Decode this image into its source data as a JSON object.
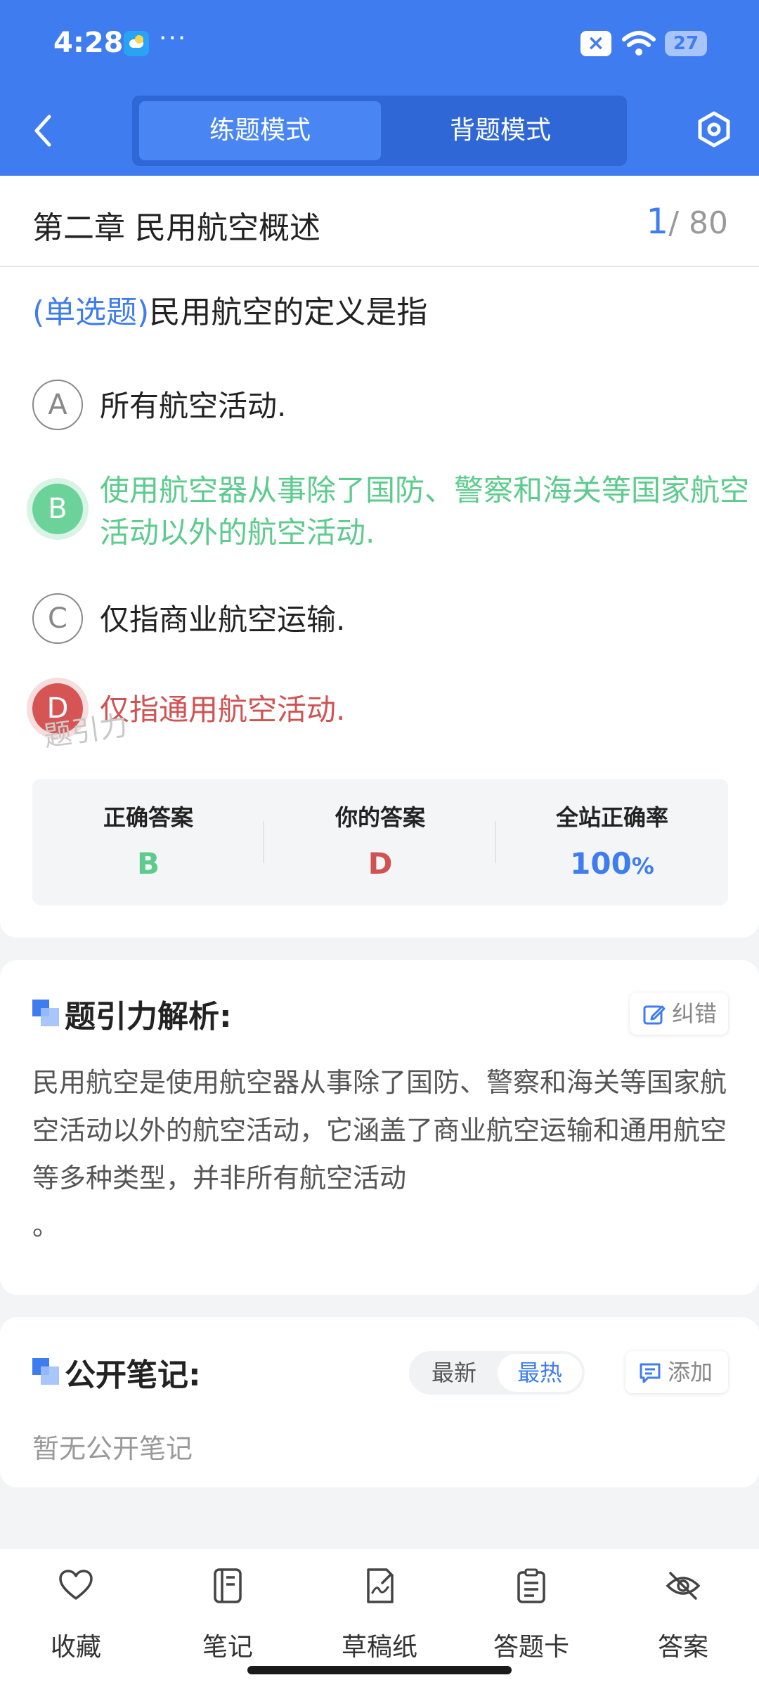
{
  "status_bar": {
    "time": "4:28",
    "more": "···",
    "battery": "27"
  },
  "header": {
    "tabs": [
      {
        "label": "练题模式",
        "active": true
      },
      {
        "label": "背题模式",
        "active": false
      }
    ]
  },
  "chapter": {
    "title": "第二章 民用航空概述",
    "current": "1",
    "total": "/ 80"
  },
  "question": {
    "type": "(单选题)",
    "text": "民用航空的定义是指"
  },
  "options": [
    {
      "letter": "A",
      "text": "所有航空活动.",
      "state": "normal"
    },
    {
      "letter": "B",
      "text": "使用航空器从事除了国防、警察和海关等国家航空活动以外的航空活动.",
      "state": "correct"
    },
    {
      "letter": "C",
      "text": "仅指商业航空运输.",
      "state": "normal"
    },
    {
      "letter": "D",
      "text": "仅指通用航空活动.",
      "state": "wrong"
    }
  ],
  "answer_summary": {
    "correct_label": "正确答案",
    "correct_value": "B",
    "yours_label": "你的答案",
    "yours_value": "D",
    "rate_label": "全站正确率",
    "rate_value": "100",
    "rate_unit": "%"
  },
  "watermark": "题引力",
  "analysis": {
    "title": "题引力解析:",
    "report_label": "纠错",
    "text": "民用航空是使用航空器从事除了国防、警察和海关等国家航空活动以外的航空活动，它涵盖了商业航空运输和通用航空等多种类型，并非所有航空活动\n。"
  },
  "notes": {
    "title": "公开笔记:",
    "sort_newest": "最新",
    "sort_hottest": "最热",
    "add_label": "添加",
    "empty_text": "暂无公开笔记"
  },
  "bottom_nav": [
    {
      "label": "收藏",
      "icon": "heart-icon"
    },
    {
      "label": "笔记",
      "icon": "notebook-icon"
    },
    {
      "label": "草稿纸",
      "icon": "draft-icon"
    },
    {
      "label": "答题卡",
      "icon": "clipboard-icon"
    },
    {
      "label": "答案",
      "icon": "eye-off-icon"
    }
  ],
  "colors": {
    "brand": "#3f7cf0",
    "correct": "#5ccb8d",
    "wrong": "#d05252"
  }
}
